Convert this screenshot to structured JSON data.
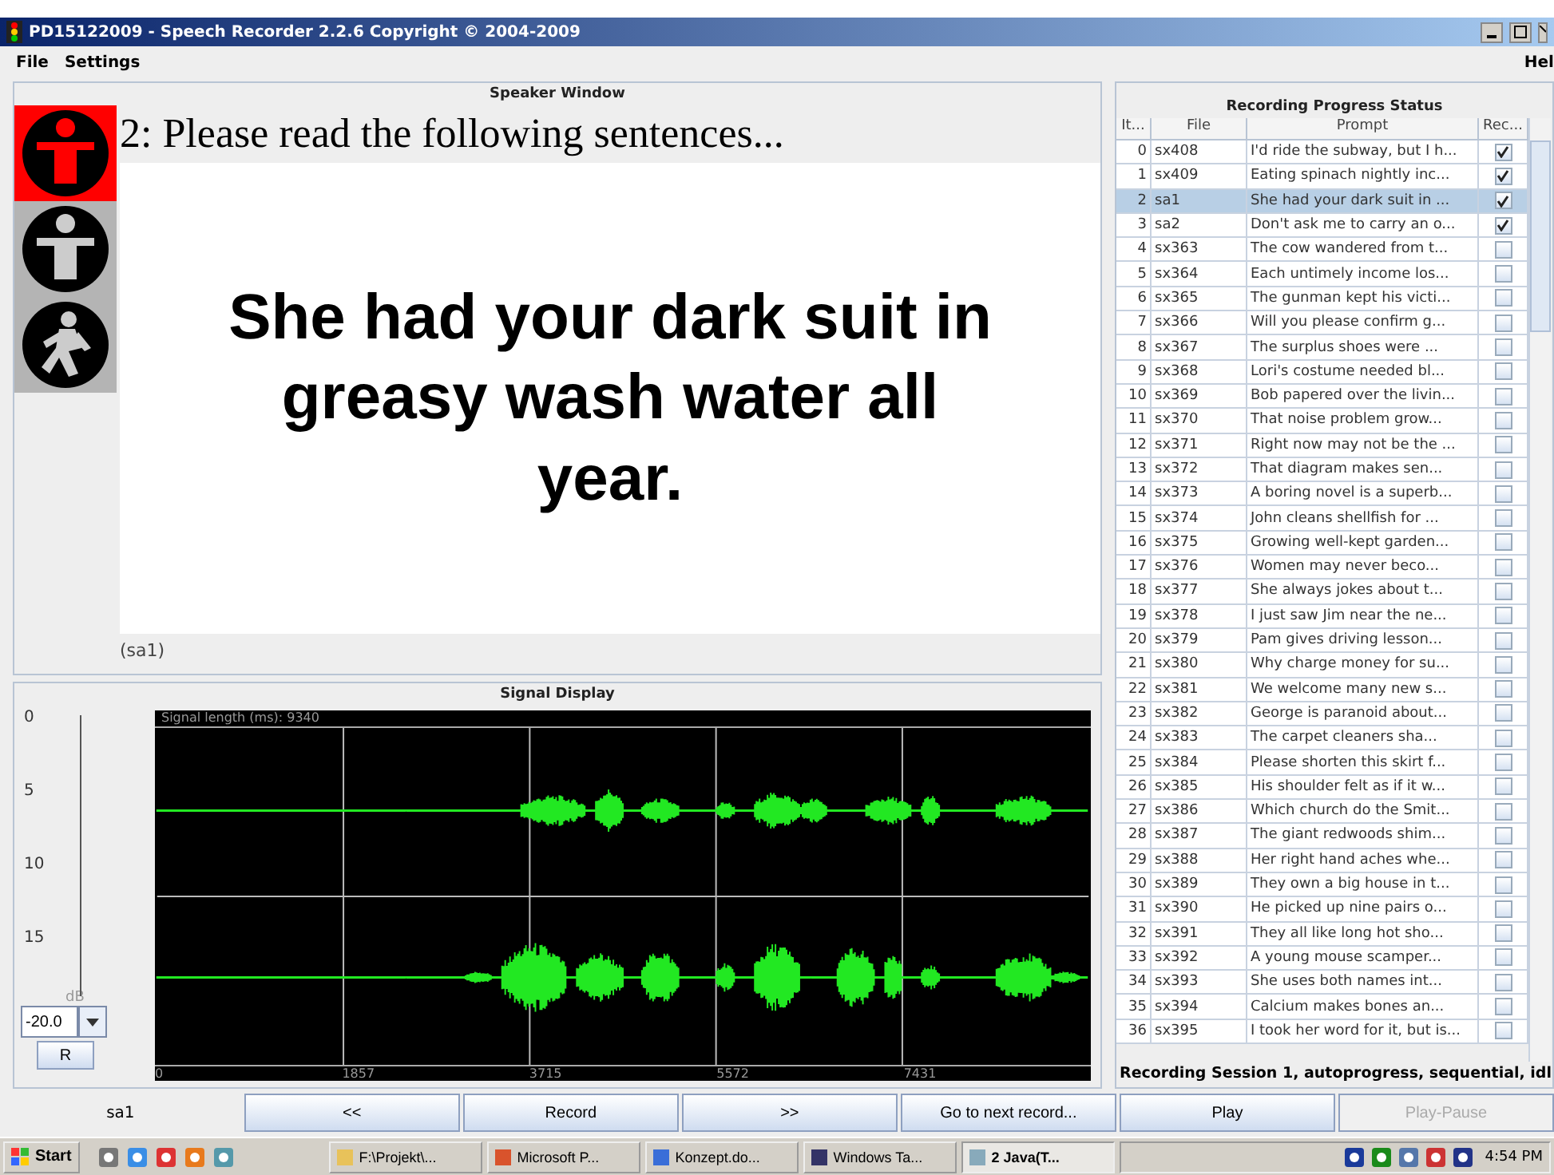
{
  "window": {
    "title": "PD15122009 - Speech Recorder 2.2.6 Copyright © 2004-2009"
  },
  "menu": [
    "File",
    "Settings"
  ],
  "menu_right": "Hel",
  "speaker_window": {
    "title": "Speaker Window",
    "lights": [
      {
        "selected": true
      },
      {
        "selected": false
      },
      {
        "selected": false
      }
    ],
    "instruction": "2: Please read the following sentences...",
    "prompt": "She had your dark suit in greasy wash water all year.",
    "code": "(sa1)"
  },
  "signal_display": {
    "title": "Signal Display",
    "length": "Signal length (ms): 9340",
    "x_ticks": [
      "0",
      "1857",
      "3715",
      "5572",
      "7431"
    ],
    "scale": [
      "0",
      "5",
      "10",
      "15"
    ],
    "unit": "dB",
    "gain": "-20.0",
    "reset": "R"
  },
  "progress": {
    "title": "Recording Progress Status",
    "columns": [
      "It...",
      "File",
      "Prompt",
      "Rec..."
    ],
    "rows": [
      {
        "index": "0",
        "file": "sx408",
        "prompt": "I'd ride the subway, but I h...",
        "recorded": true,
        "selected": false
      },
      {
        "index": "1",
        "file": "sx409",
        "prompt": "Eating spinach nightly inc...",
        "recorded": true,
        "selected": false
      },
      {
        "index": "2",
        "file": "sa1",
        "prompt": "She had your dark suit in ...",
        "recorded": true,
        "selected": true
      },
      {
        "index": "3",
        "file": "sa2",
        "prompt": "Don't ask me to carry an o...",
        "recorded": true,
        "selected": false
      },
      {
        "index": "4",
        "file": "sx363",
        "prompt": "The cow wandered from t...",
        "recorded": false,
        "selected": false
      },
      {
        "index": "5",
        "file": "sx364",
        "prompt": "Each untimely income los...",
        "recorded": false,
        "selected": false
      },
      {
        "index": "6",
        "file": "sx365",
        "prompt": "The gunman kept his victi...",
        "recorded": false,
        "selected": false
      },
      {
        "index": "7",
        "file": "sx366",
        "prompt": "Will you please confirm g...",
        "recorded": false,
        "selected": false
      },
      {
        "index": "8",
        "file": "sx367",
        "prompt": "The surplus shoes were ...",
        "recorded": false,
        "selected": false
      },
      {
        "index": "9",
        "file": "sx368",
        "prompt": "Lori's costume needed bl...",
        "recorded": false,
        "selected": false
      },
      {
        "index": "10",
        "file": "sx369",
        "prompt": "Bob papered over the livin...",
        "recorded": false,
        "selected": false
      },
      {
        "index": "11",
        "file": "sx370",
        "prompt": "That noise problem grow...",
        "recorded": false,
        "selected": false
      },
      {
        "index": "12",
        "file": "sx371",
        "prompt": "Right now may not be the ...",
        "recorded": false,
        "selected": false
      },
      {
        "index": "13",
        "file": "sx372",
        "prompt": "That diagram makes sen...",
        "recorded": false,
        "selected": false
      },
      {
        "index": "14",
        "file": "sx373",
        "prompt": "A boring novel is a superb...",
        "recorded": false,
        "selected": false
      },
      {
        "index": "15",
        "file": "sx374",
        "prompt": "John cleans shellfish for ...",
        "recorded": false,
        "selected": false
      },
      {
        "index": "16",
        "file": "sx375",
        "prompt": "Growing well-kept garden...",
        "recorded": false,
        "selected": false
      },
      {
        "index": "17",
        "file": "sx376",
        "prompt": "Women may never beco...",
        "recorded": false,
        "selected": false
      },
      {
        "index": "18",
        "file": "sx377",
        "prompt": "She always jokes about t...",
        "recorded": false,
        "selected": false
      },
      {
        "index": "19",
        "file": "sx378",
        "prompt": "I just saw Jim near the ne...",
        "recorded": false,
        "selected": false
      },
      {
        "index": "20",
        "file": "sx379",
        "prompt": "Pam gives driving lesson...",
        "recorded": false,
        "selected": false
      },
      {
        "index": "21",
        "file": "sx380",
        "prompt": "Why charge money for su...",
        "recorded": false,
        "selected": false
      },
      {
        "index": "22",
        "file": "sx381",
        "prompt": "We welcome many new s...",
        "recorded": false,
        "selected": false
      },
      {
        "index": "23",
        "file": "sx382",
        "prompt": "George is paranoid about...",
        "recorded": false,
        "selected": false
      },
      {
        "index": "24",
        "file": "sx383",
        "prompt": "The carpet cleaners sha...",
        "recorded": false,
        "selected": false
      },
      {
        "index": "25",
        "file": "sx384",
        "prompt": "Please shorten this skirt f...",
        "recorded": false,
        "selected": false
      },
      {
        "index": "26",
        "file": "sx385",
        "prompt": "His shoulder felt as if it w...",
        "recorded": false,
        "selected": false
      },
      {
        "index": "27",
        "file": "sx386",
        "prompt": "Which church do the Smit...",
        "recorded": false,
        "selected": false
      },
      {
        "index": "28",
        "file": "sx387",
        "prompt": "The giant redwoods shim...",
        "recorded": false,
        "selected": false
      },
      {
        "index": "29",
        "file": "sx388",
        "prompt": "Her right hand aches whe...",
        "recorded": false,
        "selected": false
      },
      {
        "index": "30",
        "file": "sx389",
        "prompt": "They own a big house in t...",
        "recorded": false,
        "selected": false
      },
      {
        "index": "31",
        "file": "sx390",
        "prompt": "He picked up nine pairs o...",
        "recorded": false,
        "selected": false
      },
      {
        "index": "32",
        "file": "sx391",
        "prompt": "They all like long hot sho...",
        "recorded": false,
        "selected": false
      },
      {
        "index": "33",
        "file": "sx392",
        "prompt": "A young mouse scamper...",
        "recorded": false,
        "selected": false
      },
      {
        "index": "34",
        "file": "sx393",
        "prompt": "She uses both names int...",
        "recorded": false,
        "selected": false
      },
      {
        "index": "35",
        "file": "sx394",
        "prompt": "Calcium makes bones an...",
        "recorded": false,
        "selected": false
      },
      {
        "index": "36",
        "file": "sx395",
        "prompt": "I took her word for it, but is...",
        "recorded": false,
        "selected": false
      }
    ],
    "status": "Recording Session 1, autoprogress, sequential, idl"
  },
  "controls": {
    "item": "sa1",
    "buttons": [
      {
        "label": "<<",
        "disabled": false
      },
      {
        "label": "Record",
        "disabled": false
      },
      {
        "label": ">>",
        "disabled": false
      },
      {
        "label": "Go to next record...",
        "disabled": false
      },
      {
        "label": "Play",
        "disabled": false
      },
      {
        "label": "Play-Pause",
        "disabled": true
      }
    ]
  },
  "taskbar": {
    "start": "Start",
    "tasks": [
      {
        "label": "F:\\Projekt\\...",
        "selected": false
      },
      {
        "label": "Microsoft P...",
        "selected": false
      },
      {
        "label": "Konzept.do...",
        "selected": false
      },
      {
        "label": "Windows Ta...",
        "selected": false
      },
      {
        "label": "2 Java(T...",
        "selected": true
      }
    ],
    "clock": "4:54 PM"
  }
}
